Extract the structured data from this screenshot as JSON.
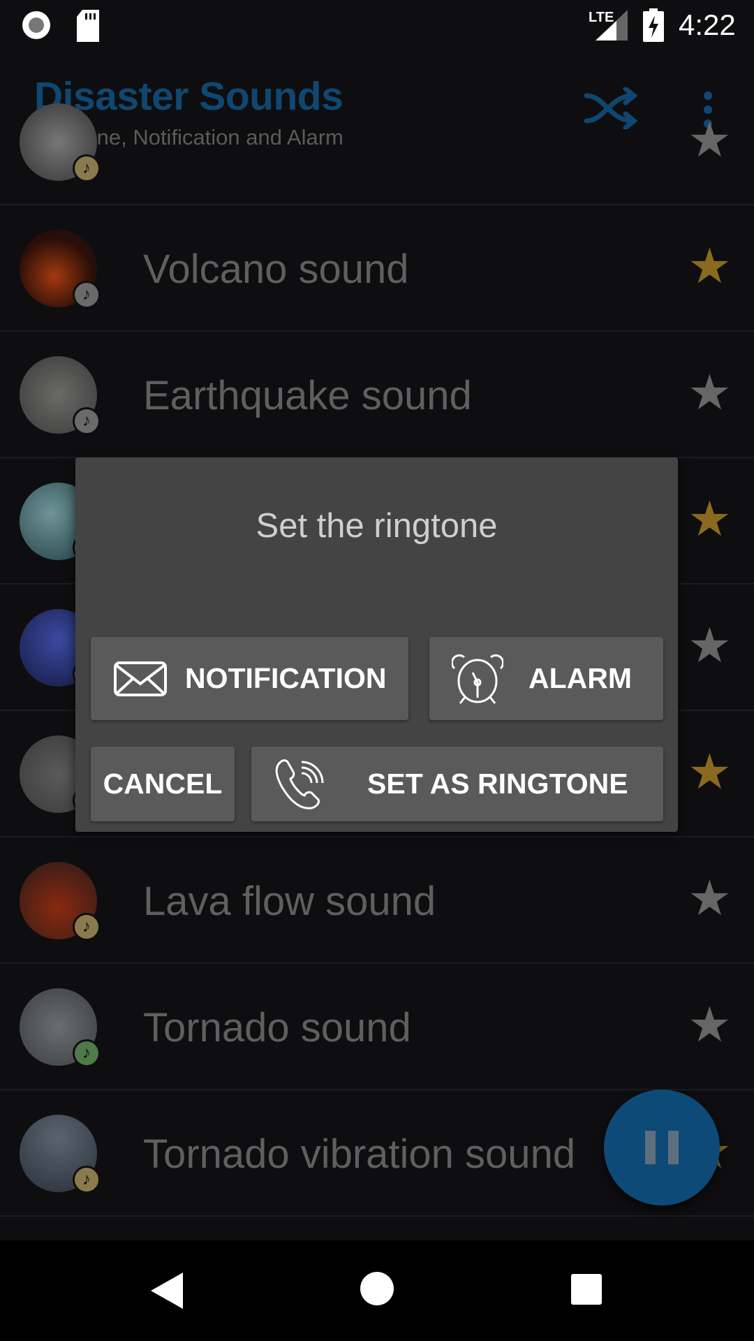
{
  "status_bar": {
    "time": "4:22",
    "network": "LTE",
    "icons": [
      "record-icon",
      "sd-card-icon",
      "signal-icon",
      "battery-charging-icon"
    ]
  },
  "app_bar": {
    "title": "Disaster Sounds",
    "subtitle": "Ringtone, Notification and Alarm",
    "actions": [
      "shuffle-icon",
      "more-vert-icon"
    ]
  },
  "colors": {
    "accent": "#0f4771",
    "star_active": "#8a6a1e",
    "star_inactive": "#666666",
    "dialog_bg": "#444444",
    "button_bg": "#5a5a5a"
  },
  "list": [
    {
      "name": "",
      "favorite": false,
      "badge_color": "#8a7a4e"
    },
    {
      "name": "Volcano sound",
      "favorite": true,
      "badge_color": "#6a6a6a"
    },
    {
      "name": "Earthquake sound",
      "favorite": false,
      "badge_color": "#6a6a6a"
    },
    {
      "name": "",
      "favorite": true,
      "badge_color": "#6a6a6a"
    },
    {
      "name": "",
      "favorite": false,
      "badge_color": "#6a6a6a"
    },
    {
      "name": "",
      "favorite": true,
      "badge_color": "#6a6a6a"
    },
    {
      "name": "Lava flow sound",
      "favorite": false,
      "badge_color": "#8a7a4e"
    },
    {
      "name": "Tornado sound",
      "favorite": false,
      "badge_color": "#4f7a4a"
    },
    {
      "name": "Tornado vibration sound",
      "favorite": true,
      "badge_color": "#8a7a4e"
    }
  ],
  "dialog": {
    "title": "Set the ringtone",
    "notification": "NOTIFICATION",
    "alarm": "ALARM",
    "cancel": "CANCEL",
    "set_ringtone": "SET AS RINGTONE"
  },
  "fab": {
    "icon": "pause-icon"
  },
  "nav": [
    "back-icon",
    "home-icon",
    "recents-icon"
  ]
}
